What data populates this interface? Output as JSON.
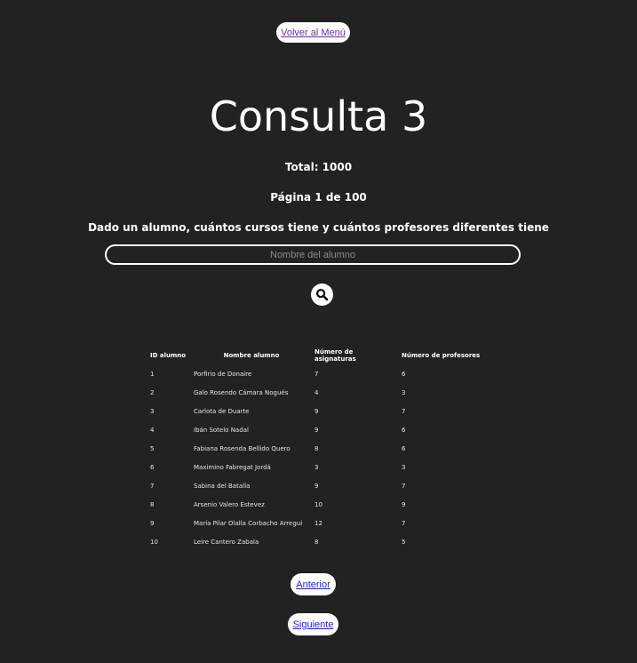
{
  "nav": {
    "back_label": "Volver al Menú"
  },
  "header": {
    "title": "Consulta 3",
    "total": "Total: 1000",
    "page": "Página 1 de 100",
    "description": "Dado un alumno, cuántos cursos tiene y cuántos profesores diferentes tiene"
  },
  "search": {
    "placeholder": "Nombre del alumno",
    "value": "",
    "icon": "search-icon"
  },
  "table": {
    "headers": [
      "ID alumno",
      "Nombre alumno",
      "Número de asignaturas",
      "Número de profesores"
    ],
    "rows": [
      [
        "1",
        "Porfirio de Donaire",
        "7",
        "6"
      ],
      [
        "2",
        "Galo Rosendo Cámara Nogués",
        "4",
        "3"
      ],
      [
        "3",
        "Carlota de Duarte",
        "9",
        "7"
      ],
      [
        "4",
        "Ibán Sotelo Nadal",
        "9",
        "6"
      ],
      [
        "5",
        "Fabiana Rosenda Bellido Quero",
        "8",
        "6"
      ],
      [
        "6",
        "Maximino Fabregat Jordá",
        "3",
        "3"
      ],
      [
        "7",
        "Sabina del Batalla",
        "9",
        "7"
      ],
      [
        "8",
        "Arsenio Valero Estevez",
        "10",
        "9"
      ],
      [
        "9",
        "María Pilar Olalla Corbacho Arregui",
        "12",
        "7"
      ],
      [
        "10",
        "Leire Cantero Zabala",
        "8",
        "5"
      ]
    ]
  },
  "pagination": {
    "prev_label": "Anterior",
    "next_label": "Siguiente"
  },
  "colors": {
    "background": "#222222",
    "text": "#ffffff",
    "link_visited": "#6a2fa0",
    "link": "#1a1aee"
  }
}
